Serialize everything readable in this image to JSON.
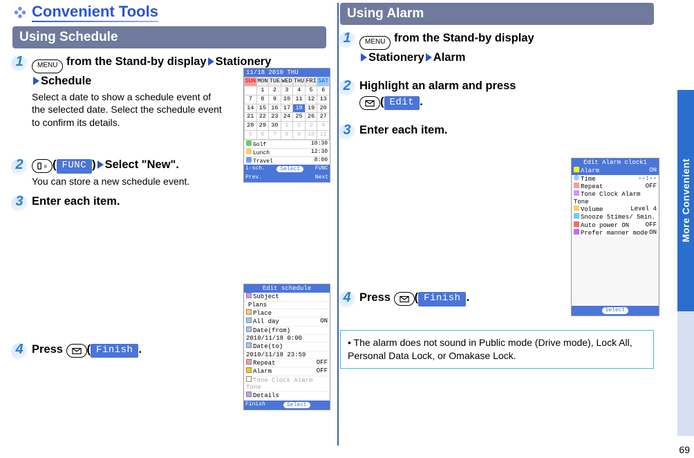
{
  "page_number": "69",
  "side_tab": "More Convenient",
  "left": {
    "title": "Convenient Tools",
    "section": "Using Schedule",
    "steps": {
      "s1": {
        "num": "1",
        "key_label": "MENU",
        "text_a": " from the Stand-by display",
        "nav1": "Stationery",
        "nav2": "Schedule",
        "sub": "Select a date to show a schedule event of the selected date. Select the schedule event to confirm its details."
      },
      "s2": {
        "num": "2",
        "softkey": "FUNC",
        "text_a": "Select \"New\".",
        "sub": "You can store a new schedule event."
      },
      "s3": {
        "num": "3",
        "text": "Enter each item."
      },
      "s4": {
        "num": "4",
        "text_a": "Press ",
        "softkey": "Finish",
        "text_b": "."
      }
    },
    "calendar_shot": {
      "header": "11/18 2010  THU",
      "days": [
        "SUN",
        "MON",
        "TUE",
        "WED",
        "THU",
        "FRI",
        "SAT"
      ],
      "rows": [
        [
          "",
          "1",
          "2",
          "3",
          "4",
          "5",
          "6"
        ],
        [
          "7",
          "8",
          "9",
          "10",
          "11",
          "12",
          "13"
        ],
        [
          "14",
          "15",
          "16",
          "17",
          "18",
          "19",
          "20"
        ],
        [
          "21",
          "22",
          "23",
          "24",
          "25",
          "26",
          "27"
        ],
        [
          "28",
          "29",
          "30",
          "1",
          "2",
          "3",
          "4"
        ],
        [
          "5",
          "6",
          "7",
          "8",
          "9",
          "10",
          "11"
        ]
      ],
      "today": "18",
      "agenda": [
        {
          "label": "Golf",
          "time": "10:30"
        },
        {
          "label": "Lunch",
          "time": "12:30"
        },
        {
          "label": "Travel",
          "time": "8:00"
        }
      ],
      "soft_left": "i-sch.",
      "soft_center": "Select",
      "soft_right": "FUNC",
      "soft_left2": "Prev.",
      "soft_right2": "Next"
    },
    "edit_shot": {
      "title": "Edit schedule",
      "rows": [
        {
          "l": "Subject",
          "r": ""
        },
        {
          "l": "Plans",
          "r": ""
        },
        {
          "l": "Place",
          "r": ""
        },
        {
          "l": "All day",
          "r": "ON"
        },
        {
          "l": "Date(from)",
          "r": ""
        },
        {
          "l": " 2010/11/18  0:00",
          "r": ""
        },
        {
          "l": "Date(to)",
          "r": ""
        },
        {
          "l": " 2010/11/18 23:59",
          "r": ""
        },
        {
          "l": "Repeat",
          "r": "OFF"
        },
        {
          "l": "Alarm",
          "r": "OFF"
        },
        {
          "l": "Tone  Clock Alarm Tone",
          "r": ""
        },
        {
          "l": "Details",
          "r": ""
        }
      ],
      "soft_left": "Finish",
      "soft_center": "Select"
    }
  },
  "right": {
    "section": "Using Alarm",
    "steps": {
      "s1": {
        "num": "1",
        "key_label": "MENU",
        "text_a": " from the Stand-by display",
        "nav1": "Stationery",
        "nav2": "Alarm"
      },
      "s2": {
        "num": "2",
        "text_a": "Highlight an alarm and press ",
        "softkey": "Edit",
        "text_b": "."
      },
      "s3": {
        "num": "3",
        "text": "Enter each item."
      },
      "s4": {
        "num": "4",
        "text_a": "Press ",
        "softkey": "Finish",
        "text_b": "."
      }
    },
    "alarm_shot": {
      "title": "Edit Alarm clock1",
      "rows": [
        {
          "l": "Alarm",
          "r": "ON"
        },
        {
          "l": "Time",
          "r": "--:--"
        },
        {
          "l": "Repeat",
          "r": "OFF"
        },
        {
          "l": "Tone  Clock Alarm Tone",
          "r": ""
        },
        {
          "l": "Volume",
          "r": "Level 4"
        },
        {
          "l": "Snooze   5times/ 5min.",
          "r": ""
        },
        {
          "l": "Auto power ON",
          "r": "OFF"
        },
        {
          "l": "Prefer manner mode",
          "r": "ON"
        }
      ],
      "soft_center": "Select"
    },
    "note": "The alarm does not sound in Public mode (Drive mode), Lock All, Personal Data Lock, or Omakase Lock."
  }
}
